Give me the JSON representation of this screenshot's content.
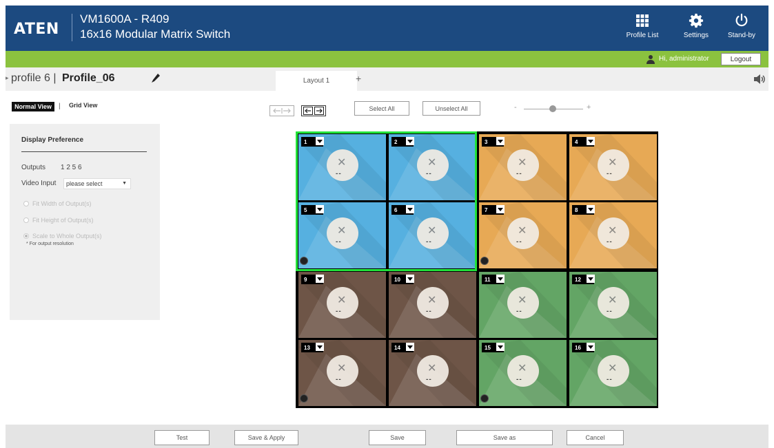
{
  "header": {
    "logo": "ATEN",
    "title_line1": "VM1600A - R409",
    "title_line2": "16x16 Modular Matrix Switch",
    "buttons": [
      {
        "label": "Profile List",
        "icon": "grid-icon"
      },
      {
        "label": "Settings",
        "icon": "gear-icon"
      },
      {
        "label": "Stand-by",
        "icon": "power-icon"
      }
    ]
  },
  "user_bar": {
    "greeting": "Hi, administrator",
    "logout_label": "Logout"
  },
  "profile": {
    "number": "profile 6 |",
    "name": "Profile_06",
    "layout_tab": "Layout 1",
    "add_tab": "+"
  },
  "view_toggle": {
    "normal": "Normal View",
    "separator": "|",
    "grid": "Grid View"
  },
  "display_preference": {
    "title": "Display Preference",
    "outputs_label": "Outputs",
    "outputs_value": "1 2 5 6",
    "video_input_label": "Video Input",
    "video_input_value": "please select",
    "options": [
      {
        "label": "Fit Width of Output(s)",
        "selected": false
      },
      {
        "label": "Fit Height of Output(s)",
        "selected": false
      },
      {
        "label": "Scale to Whole Output(s)",
        "selected": true
      }
    ],
    "note": "* For output resolution"
  },
  "toolbar": {
    "select_all": "Select All",
    "unselect_all": "Unselect All",
    "zoom_minus": "-",
    "zoom_plus": "+"
  },
  "outputs": [
    {
      "num": "1",
      "label": "--",
      "color": "#56b0e0"
    },
    {
      "num": "2",
      "label": "--",
      "color": "#56b0e0"
    },
    {
      "num": "3",
      "label": "--",
      "color": "#e7a955"
    },
    {
      "num": "4",
      "label": "--",
      "color": "#e7a955"
    },
    {
      "num": "5",
      "label": "--",
      "color": "#56b0e0"
    },
    {
      "num": "6",
      "label": "--",
      "color": "#56b0e0"
    },
    {
      "num": "7",
      "label": "--",
      "color": "#e7a955"
    },
    {
      "num": "8",
      "label": "--",
      "color": "#e7a955"
    },
    {
      "num": "9",
      "label": "--",
      "color": "#6e5547"
    },
    {
      "num": "10",
      "label": "--",
      "color": "#6e5547"
    },
    {
      "num": "11",
      "label": "--",
      "color": "#63a565"
    },
    {
      "num": "12",
      "label": "--",
      "color": "#63a565"
    },
    {
      "num": "13",
      "label": "--",
      "color": "#6e5547"
    },
    {
      "num": "14",
      "label": "--",
      "color": "#6e5547"
    },
    {
      "num": "15",
      "label": "--",
      "color": "#63a565"
    },
    {
      "num": "16",
      "label": "--",
      "color": "#63a565"
    }
  ],
  "footer": {
    "test": "Test",
    "save_apply": "Save & Apply",
    "save": "Save",
    "save_as": "Save as",
    "cancel": "Cancel"
  },
  "colors": {
    "header_bg": "#1c4a80",
    "accent_green": "#8bc23f",
    "selected_border": "#22e23a"
  }
}
